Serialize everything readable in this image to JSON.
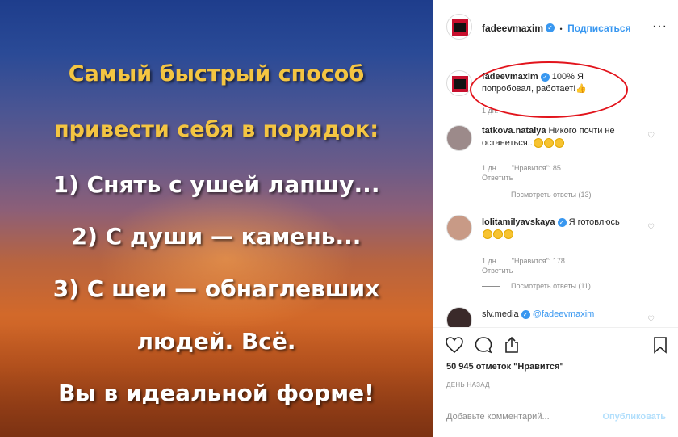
{
  "image_text": [
    "Самый быстрый способ",
    "привести себя в порядок:",
    "1) Снять с ушей лапшу...",
    "2) С души — камень...",
    "3) С шеи — обнаглевших",
    "людей. Всё.",
    "Вы в идеальной форме!"
  ],
  "header": {
    "username": "fadeevmaxim",
    "separator": "•",
    "follow_label": "Подписаться",
    "more_label": "···"
  },
  "caption": {
    "username": "fadeevmaxim",
    "text": "100% Я попробовал, работает!",
    "time": "1 дн."
  },
  "comments": [
    {
      "username": "tatkova.natalya",
      "text": "Никого почти не останеться..",
      "time": "1 дн.",
      "likes": "\"Нравится\": 85",
      "reply": "Ответить",
      "view_replies": "Посмотреть ответы (13)"
    },
    {
      "username": "lolitamilyavskaya",
      "text": "Я готовлюсь",
      "time": "1 дн.",
      "likes": "\"Нравится\": 178",
      "reply": "Ответить",
      "view_replies": "Посмотреть ответы (11)"
    },
    {
      "username": "slv.media",
      "text": "@fadeevmaxim"
    }
  ],
  "actions": {
    "likes_text": "50 945 отметок \"Нравится\"",
    "date": "День назад"
  },
  "add_comment": {
    "placeholder": "Добавьте комментарий...",
    "publish_label": "Опубликовать"
  },
  "colors": {
    "link_blue": "#3897f0",
    "annotation_red": "#e2141c",
    "text_yellow": "#f4c542"
  }
}
